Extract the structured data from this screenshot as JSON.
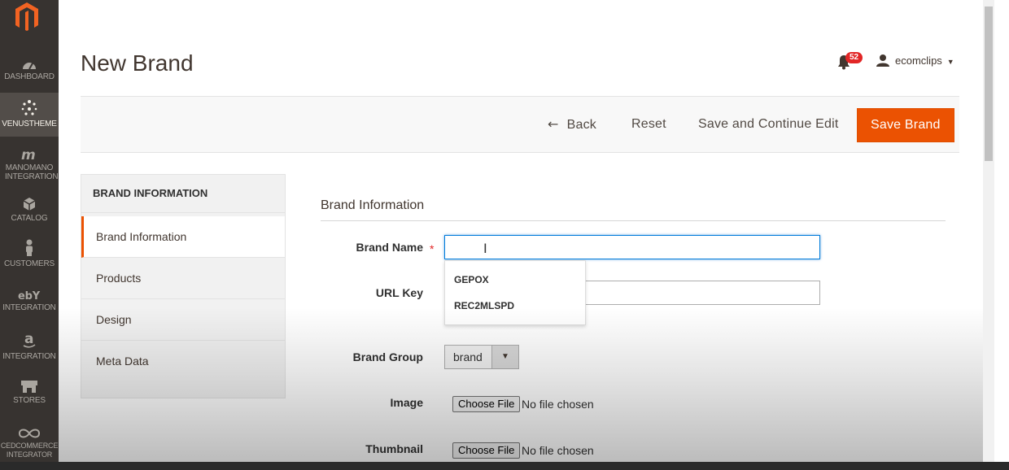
{
  "sidebar": {
    "items": [
      {
        "label": "DASHBOARD",
        "icon": "dashboard-icon"
      },
      {
        "label": "VENUSTHEME",
        "icon": "venustheme-icon"
      },
      {
        "label": "MANOMANO INTEGRATION",
        "icon": "manomano-icon"
      },
      {
        "label": "CATALOG",
        "icon": "catalog-box-icon"
      },
      {
        "label": "CUSTOMERS",
        "icon": "customers-person-icon"
      },
      {
        "label": "INTEGRATION",
        "icon": "ebay-icon"
      },
      {
        "label": "INTEGRATION",
        "icon": "amazon-icon"
      },
      {
        "label": "STORES",
        "icon": "stores-icon"
      },
      {
        "label": "CEDCOMMERCE INTEGRATOR",
        "icon": "infinity-icon"
      }
    ]
  },
  "header": {
    "title": "New Brand",
    "notification_count": "52",
    "username": "ecomclips"
  },
  "actions": {
    "back": "Back",
    "reset": "Reset",
    "save_continue": "Save and Continue Edit",
    "save": "Save Brand"
  },
  "tabs": {
    "heading": "BRAND INFORMATION",
    "items": [
      "Brand Information",
      "Products",
      "Design",
      "Meta Data"
    ]
  },
  "form": {
    "section_title": "Brand Information",
    "brand_name_label": "Brand Name",
    "brand_name_value": "",
    "autocomplete": [
      "GEPOX",
      "REC2MLSPD"
    ],
    "url_key_label": "URL Key",
    "url_key_value": "",
    "brand_group_label": "Brand Group",
    "brand_group_value": "brand",
    "image_label": "Image",
    "thumbnail_label": "Thumbnail",
    "choose_file": "Choose File",
    "no_file": "No file chosen"
  },
  "colors": {
    "sidebar": "#373330",
    "accent": "#eb5202",
    "focus": "#007bdb"
  }
}
